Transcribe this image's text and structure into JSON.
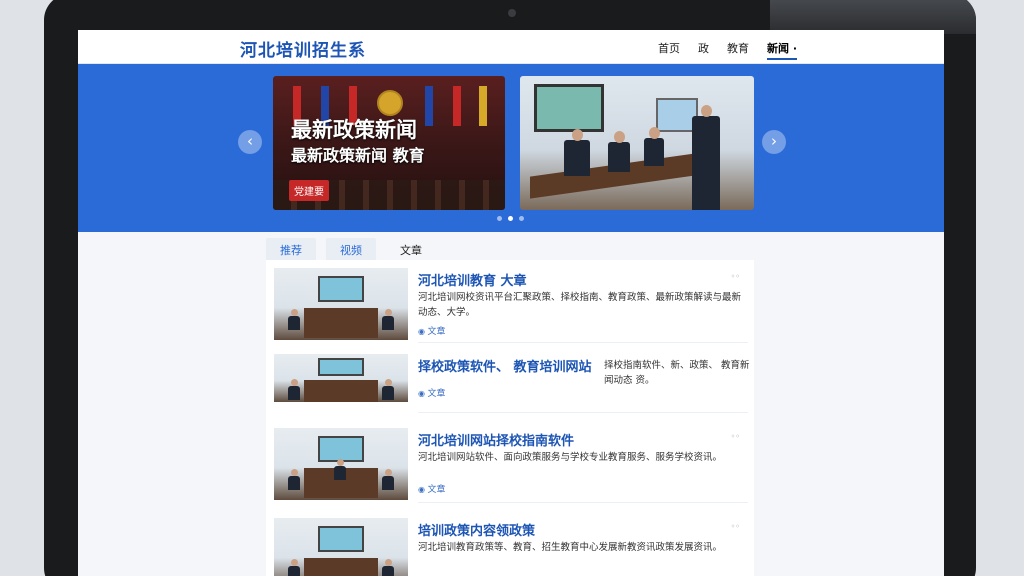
{
  "header": {
    "logo": "河北培训招生系",
    "nav": [
      "首页",
      "政",
      "教育",
      "新闻 ·"
    ]
  },
  "banner": {
    "slide1": {
      "line1": "最新政策新闻",
      "line2": "最新政策新闻 教育",
      "tag": "党建要"
    },
    "prev_glyph": "‹",
    "next_glyph": "›",
    "dots": 3,
    "active_dot": 1
  },
  "tabs": [
    "推荐",
    "视频",
    "文章"
  ],
  "active_tab": 2,
  "articles": [
    {
      "title": "河北培训教育 大章",
      "desc": "河北培训网校资讯平台汇聚政策、择校指南、教育政策、最新政策解读与最新动态、大学。",
      "tag": "文章",
      "meta": "◦◦"
    },
    {
      "title": "择校政策软件、 教育培训网站",
      "desc_inline": "择校指南软件、新、政策、 教育新闻动态 资。",
      "tag": "文章"
    },
    {
      "title": "河北培训网站择校指南软件",
      "desc": "河北培训网站软件、面向政策服务与学校专业教育服务、服务学校资讯。",
      "tag": "文章",
      "meta": "◦◦"
    },
    {
      "title": "培训政策内容领政策",
      "desc": "河北培训教育政策等、教育、招生教育中心发展新教资讯政策发展资讯。",
      "tag": "",
      "meta": "◦◦"
    }
  ],
  "colors": {
    "brand_blue": "#2a6bd7",
    "title_blue": "#1d55b4"
  }
}
